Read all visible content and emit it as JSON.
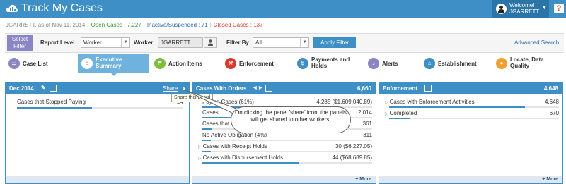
{
  "header": {
    "title": "Track My Cases",
    "welcome_label": "Welcome!",
    "username": "JGARRETT",
    "help_label": "?"
  },
  "status": {
    "as_of": "JGARRETT, as of Nov 11, 2014",
    "open_cases": "Open Cases : 7,227",
    "inactive_cases": "Inactive/Suspended : 71",
    "closed_cases": "Closed Cases : 137"
  },
  "filters": {
    "select_filter_label": "Select Filter",
    "report_level_label": "Report Level",
    "report_level_value": "Worker",
    "worker_label": "Worker",
    "worker_value": "JGARRETT",
    "filter_by_label": "Filter By",
    "filter_by_value": "All",
    "apply_label": "Apply Filter",
    "advanced_search_label": "Advanced Search"
  },
  "nav": {
    "items": [
      {
        "label": "Case List",
        "icon": "list-icon",
        "color": "#8a85c4"
      },
      {
        "label": "Executive Summary",
        "icon": "home-icon",
        "color": "#ffffff"
      },
      {
        "label": "Action Items",
        "icon": "flag-icon",
        "color": "#7cbf3a"
      },
      {
        "label": "Enforcement",
        "icon": "gavel-icon",
        "color": "#d8392b"
      },
      {
        "label": "Payments and Holds",
        "icon": "money-icon",
        "color": "#3d8fc6"
      },
      {
        "label": "Alerts",
        "icon": "bell-icon",
        "color": "#8a85c4"
      },
      {
        "label": "Establishment",
        "icon": "bank-icon",
        "color": "#3d8fc6"
      },
      {
        "label": "Locate, Data Quality",
        "icon": "pin-icon",
        "color": "#f0a030"
      }
    ]
  },
  "panels": {
    "dec": {
      "title": "Dec 2014",
      "share_label": "Share",
      "close_label": "x",
      "rows": [
        {
          "label": "Cases that Stopped Paying",
          "value": "24",
          "fill": 0.45
        }
      ]
    },
    "orders": {
      "title": "Cases With Orders",
      "total": "6,660",
      "rows": [
        {
          "label": "Paying Cases (61%)",
          "value": "4,285 ($1,609,040.89)",
          "fill": 0.64
        },
        {
          "label": "Cases",
          "value": "2,014",
          "fill": 0.3
        },
        {
          "label": "Cases that",
          "value": "361",
          "fill": 0.06
        },
        {
          "label": "No Active Obligation (4%)",
          "value": "311",
          "fill": 0.05
        },
        {
          "label": "Cases with Receipt Holds",
          "value": "30 ($6,227.05)",
          "fill": 0.05
        },
        {
          "label": "Cases with Disbursement Holds",
          "value": "44 ($68,689.85)",
          "fill": 0.57
        }
      ],
      "more_label": "+ More"
    },
    "enforcement": {
      "title": "Enforcement",
      "total": "4,648",
      "rows": [
        {
          "label": "Cases with Enforcement Activities",
          "value": "4,648",
          "fill": 0.8
        },
        {
          "label": "Completed",
          "value": "670",
          "fill": 0.12
        }
      ],
      "more_label": "+ More"
    },
    "dec_more_label": "+ More"
  },
  "tooltip": "Share this board",
  "callout": "On clicking the panel 'share' icon, the panels will get shared to other workers."
}
